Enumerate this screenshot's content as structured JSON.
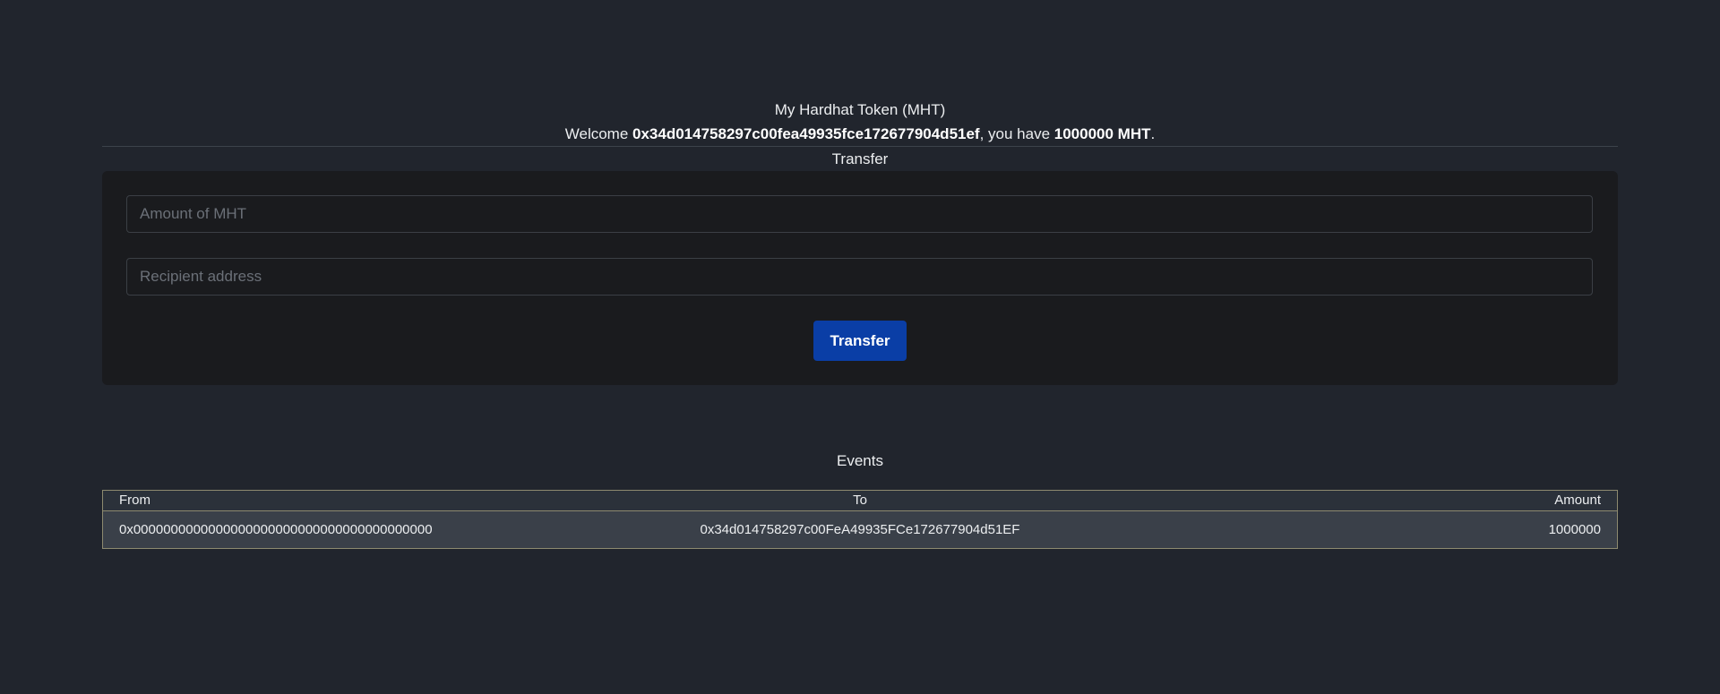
{
  "header": {
    "token_title": "My Hardhat Token (MHT)",
    "welcome_prefix": "Welcome ",
    "address": "0x34d014758297c00fea49935fce172677904d51ef",
    "welcome_middle": ", you have ",
    "balance": "1000000 MHT",
    "welcome_suffix": "."
  },
  "transfer": {
    "title": "Transfer",
    "amount_placeholder": "Amount of MHT",
    "amount_value": "",
    "recipient_placeholder": "Recipient address",
    "recipient_value": "",
    "button_label": "Transfer"
  },
  "events": {
    "title": "Events",
    "columns": [
      "From",
      "To",
      "Amount"
    ],
    "rows": [
      {
        "from": "0x0000000000000000000000000000000000000000",
        "to": "0x34d014758297c00FeA49935FCe172677904d51EF",
        "amount": "1000000"
      }
    ]
  },
  "colors": {
    "background": "#21252d",
    "card": "#1a1b1e",
    "button": "#0a3ea6",
    "table_header": "#2b313a",
    "table_row": "#3a4049",
    "table_border": "#8d8a6f"
  }
}
